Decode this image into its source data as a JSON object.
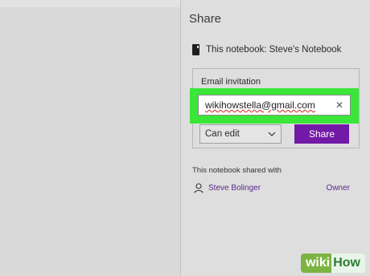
{
  "panel": {
    "title": "Share",
    "notebook_label": "This notebook: Steve's Notebook"
  },
  "invite": {
    "label": "Email invitation",
    "email_value": "wikihowstella@gmail.com",
    "clear_glyph": "✕",
    "permission_selected": "Can edit",
    "share_button": "Share"
  },
  "shared": {
    "heading": "This notebook shared with",
    "users": [
      {
        "name": "Steve Bolinger",
        "role": "Owner"
      }
    ]
  },
  "watermark": {
    "left": "wiki",
    "right": "How"
  },
  "colors": {
    "accent": "#7219a6",
    "highlight": "#39e639",
    "link": "#5a2a8a"
  },
  "icons": [
    "notebook-icon",
    "close-icon",
    "chevron-down-icon",
    "person-icon"
  ]
}
